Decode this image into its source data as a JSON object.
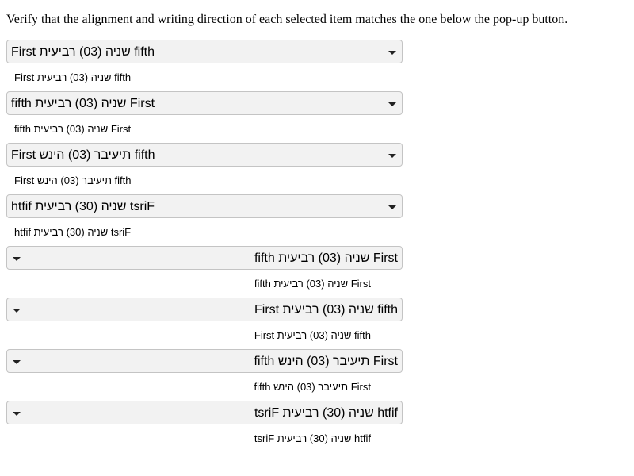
{
  "instruction": "Verify that the alignment and writing direction of each selected item matches the one below the pop-up button.",
  "icons": {
    "arrow": "chevron-down-icon"
  },
  "items": [
    {
      "selected": "First שניה (03) רביעית fifth",
      "reference": "First שניה (03) רביעית fifth"
    },
    {
      "selected": "fifth שניה (03) רביעית First",
      "reference": "fifth שניה (03) רביעית First"
    },
    {
      "selected": "First תיעיבר (03) הינש fifth",
      "reference": "First תיעיבר (03) הינש fifth"
    },
    {
      "selected": "htfif שניה (30) רביעית tsriF",
      "reference": "htfif שניה (30) רביעית tsriF"
    },
    {
      "selected": "fifth שניה (03) רביעית First",
      "reference": "fifth שניה (03) רביעית First"
    },
    {
      "selected": "First שניה (03) רביעית fifth",
      "reference": "First שניה (03) רביעית fifth"
    },
    {
      "selected": "fifth תיעיבר (03) הינש First",
      "reference": "fifth תיעיבר (03) הינש First"
    },
    {
      "selected": "tsriF שניה (30) רביעית htfif",
      "reference": "tsriF שניה (30) רביעית htfif"
    }
  ]
}
